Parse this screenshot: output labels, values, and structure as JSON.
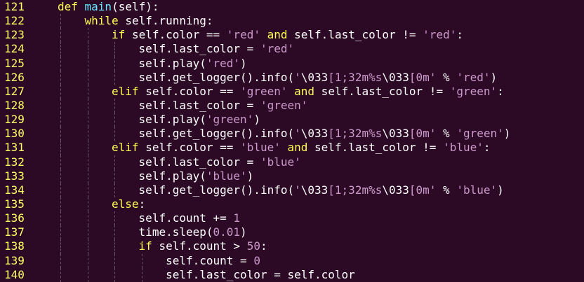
{
  "editor": {
    "colors": {
      "background": "#2c0a25",
      "line_number": "#ffff66",
      "keyword": "#ffff55",
      "string": "#cc99cc",
      "function_name": "#66e6ff",
      "text": "#ffffff"
    },
    "lines": [
      {
        "num": "121",
        "indent": 1,
        "tokens": [
          {
            "c": "k",
            "v": "def "
          },
          {
            "c": "f",
            "v": "main"
          },
          {
            "c": "t",
            "v": "(self):"
          }
        ]
      },
      {
        "num": "122",
        "indent": 2,
        "tokens": [
          {
            "c": "k",
            "v": "while "
          },
          {
            "c": "t",
            "v": "self.running:"
          }
        ]
      },
      {
        "num": "123",
        "indent": 3,
        "tokens": [
          {
            "c": "k",
            "v": "if "
          },
          {
            "c": "t",
            "v": "self.color == "
          },
          {
            "c": "s",
            "v": "'red'"
          },
          {
            "c": "t",
            "v": " "
          },
          {
            "c": "k",
            "v": "and"
          },
          {
            "c": "t",
            "v": " self.last_color != "
          },
          {
            "c": "s",
            "v": "'red'"
          },
          {
            "c": "t",
            "v": ":"
          }
        ]
      },
      {
        "num": "124",
        "indent": 4,
        "tokens": [
          {
            "c": "t",
            "v": "self.last_color = "
          },
          {
            "c": "s",
            "v": "'red'"
          }
        ]
      },
      {
        "num": "125",
        "indent": 4,
        "tokens": [
          {
            "c": "t",
            "v": "self.play("
          },
          {
            "c": "s",
            "v": "'red'"
          },
          {
            "c": "t",
            "v": ")"
          }
        ]
      },
      {
        "num": "126",
        "indent": 4,
        "tokens": [
          {
            "c": "t",
            "v": "self.get_logger().info("
          },
          {
            "c": "s",
            "v": "'"
          },
          {
            "c": "t",
            "v": "\\033"
          },
          {
            "c": "s",
            "v": "[1;32m%s"
          },
          {
            "c": "t",
            "v": "\\033"
          },
          {
            "c": "s",
            "v": "[0m'"
          },
          {
            "c": "t",
            "v": " % "
          },
          {
            "c": "s",
            "v": "'red'"
          },
          {
            "c": "t",
            "v": ")"
          }
        ]
      },
      {
        "num": "127",
        "indent": 3,
        "tokens": [
          {
            "c": "k",
            "v": "elif "
          },
          {
            "c": "t",
            "v": "self.color == "
          },
          {
            "c": "s",
            "v": "'green'"
          },
          {
            "c": "t",
            "v": " "
          },
          {
            "c": "k",
            "v": "and"
          },
          {
            "c": "t",
            "v": " self.last_color != "
          },
          {
            "c": "s",
            "v": "'green'"
          },
          {
            "c": "t",
            "v": ":"
          }
        ]
      },
      {
        "num": "128",
        "indent": 4,
        "tokens": [
          {
            "c": "t",
            "v": "self.last_color = "
          },
          {
            "c": "s",
            "v": "'green'"
          }
        ]
      },
      {
        "num": "129",
        "indent": 4,
        "tokens": [
          {
            "c": "t",
            "v": "self.play("
          },
          {
            "c": "s",
            "v": "'green'"
          },
          {
            "c": "t",
            "v": ")"
          }
        ]
      },
      {
        "num": "130",
        "indent": 4,
        "tokens": [
          {
            "c": "t",
            "v": "self.get_logger().info("
          },
          {
            "c": "s",
            "v": "'"
          },
          {
            "c": "t",
            "v": "\\033"
          },
          {
            "c": "s",
            "v": "[1;32m%s"
          },
          {
            "c": "t",
            "v": "\\033"
          },
          {
            "c": "s",
            "v": "[0m'"
          },
          {
            "c": "t",
            "v": " % "
          },
          {
            "c": "s",
            "v": "'green'"
          },
          {
            "c": "t",
            "v": ")"
          }
        ]
      },
      {
        "num": "131",
        "indent": 3,
        "tokens": [
          {
            "c": "k",
            "v": "elif "
          },
          {
            "c": "t",
            "v": "self.color == "
          },
          {
            "c": "s",
            "v": "'blue'"
          },
          {
            "c": "t",
            "v": " "
          },
          {
            "c": "k",
            "v": "and"
          },
          {
            "c": "t",
            "v": " self.last_color != "
          },
          {
            "c": "s",
            "v": "'blue'"
          },
          {
            "c": "t",
            "v": ":"
          }
        ]
      },
      {
        "num": "132",
        "indent": 4,
        "tokens": [
          {
            "c": "t",
            "v": "self.last_color = "
          },
          {
            "c": "s",
            "v": "'blue'"
          }
        ]
      },
      {
        "num": "133",
        "indent": 4,
        "tokens": [
          {
            "c": "t",
            "v": "self.play("
          },
          {
            "c": "s",
            "v": "'blue'"
          },
          {
            "c": "t",
            "v": ")"
          }
        ]
      },
      {
        "num": "134",
        "indent": 4,
        "tokens": [
          {
            "c": "t",
            "v": "self.get_logger().info("
          },
          {
            "c": "s",
            "v": "'"
          },
          {
            "c": "t",
            "v": "\\033"
          },
          {
            "c": "s",
            "v": "[1;32m%s"
          },
          {
            "c": "t",
            "v": "\\033"
          },
          {
            "c": "s",
            "v": "[0m'"
          },
          {
            "c": "t",
            "v": " % "
          },
          {
            "c": "s",
            "v": "'blue'"
          },
          {
            "c": "t",
            "v": ")"
          }
        ]
      },
      {
        "num": "135",
        "indent": 3,
        "tokens": [
          {
            "c": "k",
            "v": "else"
          },
          {
            "c": "t",
            "v": ":"
          }
        ]
      },
      {
        "num": "136",
        "indent": 4,
        "tokens": [
          {
            "c": "t",
            "v": "self.count += "
          },
          {
            "c": "n",
            "v": "1"
          }
        ]
      },
      {
        "num": "137",
        "indent": 4,
        "tokens": [
          {
            "c": "t",
            "v": "time.sleep("
          },
          {
            "c": "n",
            "v": "0.01"
          },
          {
            "c": "t",
            "v": ")"
          }
        ]
      },
      {
        "num": "138",
        "indent": 4,
        "tokens": [
          {
            "c": "k",
            "v": "if "
          },
          {
            "c": "t",
            "v": "self.count > "
          },
          {
            "c": "n",
            "v": "50"
          },
          {
            "c": "t",
            "v": ":"
          }
        ]
      },
      {
        "num": "139",
        "indent": 5,
        "tokens": [
          {
            "c": "t",
            "v": "self.count = "
          },
          {
            "c": "n",
            "v": "0"
          }
        ]
      },
      {
        "num": "140",
        "indent": 5,
        "tokens": [
          {
            "c": "t",
            "v": "self.last_color = self.color"
          }
        ]
      }
    ]
  }
}
